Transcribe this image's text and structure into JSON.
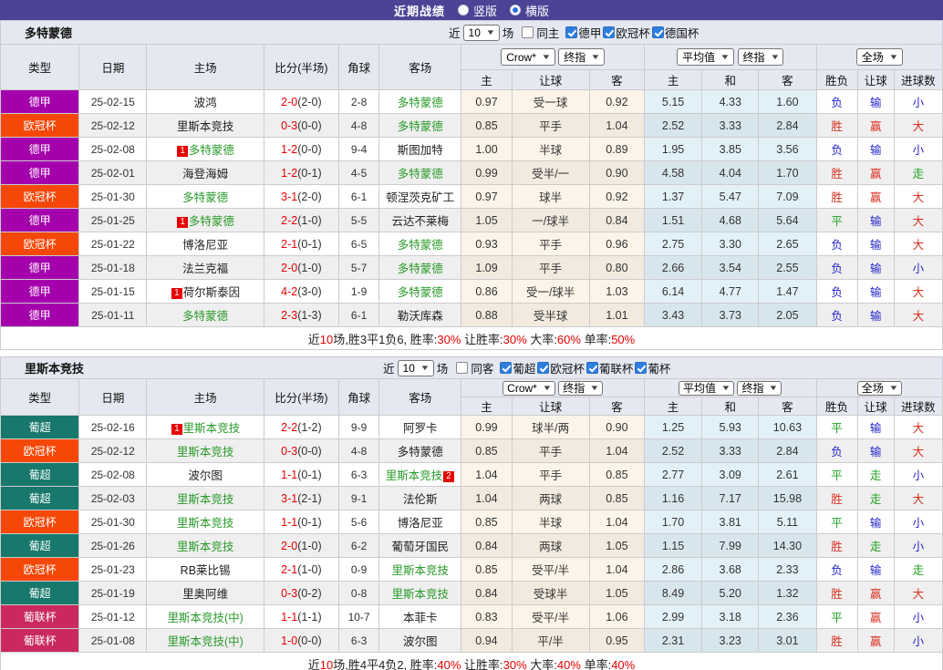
{
  "title_bar": {
    "title": "近期战绩",
    "vertical": "竖版",
    "horizontal": "横版"
  },
  "columns_left": [
    "类型",
    "日期",
    "主场",
    "比分(半场)",
    "角球",
    "客场"
  ],
  "header_row2": [
    "主",
    "让球",
    "客",
    "主",
    "和",
    "客",
    "胜负",
    "让球",
    "进球数"
  ],
  "league_colors": {
    "德甲": "#A400AC",
    "欧冠杯": "#F54708",
    "葡超": "#17786B",
    "葡联杯": "#C9295E"
  },
  "result_colors": {
    "r": "#d9301f",
    "b": "#2424c8",
    "g": "#1fa01f"
  },
  "accent_colors": {
    "titlebar": "#4B4496",
    "score_red": "#e60000",
    "team_green": "#2a9a2a",
    "rank_badge_bg": "#e60000"
  },
  "sections": [
    {
      "team": "多特蒙德",
      "filter": {
        "near": "近",
        "count": "10",
        "matches": "场",
        "same": "同主",
        "same_checked": false,
        "leagues": [
          "德甲",
          "欧冠杯",
          "德国杯"
        ]
      },
      "selects": {
        "source": "Crow*",
        "stage1": "终指",
        "avg": "平均值",
        "stage2": "终指",
        "scope": "全场"
      },
      "rows": [
        {
          "lg": "德甲",
          "d": "25-02-15",
          "h": {
            "n": "波鸿"
          },
          "ft": "2-0",
          "ht": "(2-0)",
          "cn": "2-8",
          "aw": {
            "n": "多特蒙德",
            "g": 1
          },
          "o": [
            "0.97",
            "受一球",
            "0.92"
          ],
          "v": [
            "5.15",
            "4.33",
            "1.60"
          ],
          "r": [
            [
              "负",
              "b"
            ],
            [
              "输",
              "b"
            ],
            [
              "小",
              "b"
            ]
          ]
        },
        {
          "lg": "欧冠杯",
          "d": "25-02-12",
          "h": {
            "n": "里斯本竞技"
          },
          "ft": "0-3",
          "ht": "(0-0)",
          "cn": "4-8",
          "aw": {
            "n": "多特蒙德",
            "g": 1
          },
          "o": [
            "0.85",
            "平手",
            "1.04"
          ],
          "v": [
            "2.52",
            "3.33",
            "2.84"
          ],
          "r": [
            [
              "胜",
              "r"
            ],
            [
              "赢",
              "r"
            ],
            [
              "大",
              "r"
            ]
          ]
        },
        {
          "lg": "德甲",
          "d": "25-02-08",
          "h": {
            "n": "多特蒙德",
            "g": 1,
            "rk": "1"
          },
          "ft": "1-2",
          "ht": "(0-0)",
          "cn": "9-4",
          "aw": {
            "n": "斯图加特"
          },
          "o": [
            "1.00",
            "半球",
            "0.89"
          ],
          "v": [
            "1.95",
            "3.85",
            "3.56"
          ],
          "r": [
            [
              "负",
              "b"
            ],
            [
              "输",
              "b"
            ],
            [
              "小",
              "b"
            ]
          ]
        },
        {
          "lg": "德甲",
          "d": "25-02-01",
          "h": {
            "n": "海登海姆"
          },
          "ft": "1-2",
          "ht": "(0-1)",
          "cn": "4-5",
          "aw": {
            "n": "多特蒙德",
            "g": 1
          },
          "o": [
            "0.99",
            "受半/一",
            "0.90"
          ],
          "v": [
            "4.58",
            "4.04",
            "1.70"
          ],
          "r": [
            [
              "胜",
              "r"
            ],
            [
              "赢",
              "r"
            ],
            [
              "走",
              "g"
            ]
          ]
        },
        {
          "lg": "欧冠杯",
          "d": "25-01-30",
          "h": {
            "n": "多特蒙德",
            "g": 1
          },
          "ft": "3-1",
          "ht": "(2-0)",
          "cn": "6-1",
          "aw": {
            "n": "顿涅茨克矿工"
          },
          "o": [
            "0.97",
            "球半",
            "0.92"
          ],
          "v": [
            "1.37",
            "5.47",
            "7.09"
          ],
          "r": [
            [
              "胜",
              "r"
            ],
            [
              "赢",
              "r"
            ],
            [
              "大",
              "r"
            ]
          ]
        },
        {
          "lg": "德甲",
          "d": "25-01-25",
          "h": {
            "n": "多特蒙德",
            "g": 1,
            "rk": "1"
          },
          "ft": "2-2",
          "ht": "(1-0)",
          "cn": "5-5",
          "aw": {
            "n": "云达不莱梅"
          },
          "o": [
            "1.05",
            "一/球半",
            "0.84"
          ],
          "v": [
            "1.51",
            "4.68",
            "5.64"
          ],
          "r": [
            [
              "平",
              "g"
            ],
            [
              "输",
              "b"
            ],
            [
              "大",
              "r"
            ]
          ]
        },
        {
          "lg": "欧冠杯",
          "d": "25-01-22",
          "h": {
            "n": "博洛尼亚"
          },
          "ft": "2-1",
          "ht": "(0-1)",
          "cn": "6-5",
          "aw": {
            "n": "多特蒙德",
            "g": 1
          },
          "o": [
            "0.93",
            "平手",
            "0.96"
          ],
          "v": [
            "2.75",
            "3.30",
            "2.65"
          ],
          "r": [
            [
              "负",
              "b"
            ],
            [
              "输",
              "b"
            ],
            [
              "大",
              "r"
            ]
          ]
        },
        {
          "lg": "德甲",
          "d": "25-01-18",
          "h": {
            "n": "法兰克福"
          },
          "ft": "2-0",
          "ht": "(1-0)",
          "cn": "5-7",
          "aw": {
            "n": "多特蒙德",
            "g": 1
          },
          "o": [
            "1.09",
            "平手",
            "0.80"
          ],
          "v": [
            "2.66",
            "3.54",
            "2.55"
          ],
          "r": [
            [
              "负",
              "b"
            ],
            [
              "输",
              "b"
            ],
            [
              "小",
              "b"
            ]
          ]
        },
        {
          "lg": "德甲",
          "d": "25-01-15",
          "h": {
            "n": "荷尔斯泰因",
            "rk": "1"
          },
          "ft": "4-2",
          "ht": "(3-0)",
          "cn": "1-9",
          "aw": {
            "n": "多特蒙德",
            "g": 1
          },
          "o": [
            "0.86",
            "受一/球半",
            "1.03"
          ],
          "v": [
            "6.14",
            "4.77",
            "1.47"
          ],
          "r": [
            [
              "负",
              "b"
            ],
            [
              "输",
              "b"
            ],
            [
              "大",
              "r"
            ]
          ]
        },
        {
          "lg": "德甲",
          "d": "25-01-11",
          "h": {
            "n": "多特蒙德",
            "g": 1
          },
          "ft": "2-3",
          "ht": "(1-3)",
          "cn": "6-1",
          "aw": {
            "n": "勒沃库森"
          },
          "o": [
            "0.88",
            "受半球",
            "1.01"
          ],
          "v": [
            "3.43",
            "3.73",
            "2.05"
          ],
          "r": [
            [
              "负",
              "b"
            ],
            [
              "输",
              "b"
            ],
            [
              "大",
              "r"
            ]
          ]
        }
      ],
      "summary": [
        [
          "近",
          0
        ],
        [
          "10",
          1
        ],
        [
          "场,胜3平1负6, 胜率:",
          0
        ],
        [
          "30%",
          1
        ],
        [
          " 让胜率:",
          0
        ],
        [
          "30%",
          1
        ],
        [
          " 大率:",
          0
        ],
        [
          "60%",
          1
        ],
        [
          " 单率:",
          0
        ],
        [
          "50%",
          1
        ]
      ]
    },
    {
      "team": "里斯本竞技",
      "filter": {
        "near": "近",
        "count": "10",
        "matches": "场",
        "same": "同客",
        "same_checked": false,
        "leagues": [
          "葡超",
          "欧冠杯",
          "葡联杯",
          "葡杯"
        ]
      },
      "selects": {
        "source": "Crow*",
        "stage1": "终指",
        "avg": "平均值",
        "stage2": "终指",
        "scope": "全场"
      },
      "rows": [
        {
          "lg": "葡超",
          "d": "25-02-16",
          "h": {
            "n": "里斯本竞技",
            "g": 1,
            "rk": "1"
          },
          "ft": "2-2",
          "ht": "(1-2)",
          "cn": "9-9",
          "aw": {
            "n": "阿罗卡"
          },
          "o": [
            "0.99",
            "球半/两",
            "0.90"
          ],
          "v": [
            "1.25",
            "5.93",
            "10.63"
          ],
          "r": [
            [
              "平",
              "g"
            ],
            [
              "输",
              "b"
            ],
            [
              "大",
              "r"
            ]
          ]
        },
        {
          "lg": "欧冠杯",
          "d": "25-02-12",
          "h": {
            "n": "里斯本竞技",
            "g": 1
          },
          "ft": "0-3",
          "ht": "(0-0)",
          "cn": "4-8",
          "aw": {
            "n": "多特蒙德"
          },
          "o": [
            "0.85",
            "平手",
            "1.04"
          ],
          "v": [
            "2.52",
            "3.33",
            "2.84"
          ],
          "r": [
            [
              "负",
              "b"
            ],
            [
              "输",
              "b"
            ],
            [
              "大",
              "r"
            ]
          ]
        },
        {
          "lg": "葡超",
          "d": "25-02-08",
          "h": {
            "n": "波尔图"
          },
          "ft": "1-1",
          "ht": "(0-1)",
          "cn": "6-3",
          "aw": {
            "n": "里斯本竞技",
            "g": 1,
            "rk": "2",
            "rka": 1
          },
          "o": [
            "1.04",
            "平手",
            "0.85"
          ],
          "v": [
            "2.77",
            "3.09",
            "2.61"
          ],
          "r": [
            [
              "平",
              "g"
            ],
            [
              "走",
              "g"
            ],
            [
              "小",
              "b"
            ]
          ]
        },
        {
          "lg": "葡超",
          "d": "25-02-03",
          "h": {
            "n": "里斯本竞技",
            "g": 1
          },
          "ft": "3-1",
          "ht": "(2-1)",
          "cn": "9-1",
          "aw": {
            "n": "法伦斯"
          },
          "o": [
            "1.04",
            "两球",
            "0.85"
          ],
          "v": [
            "1.16",
            "7.17",
            "15.98"
          ],
          "r": [
            [
              "胜",
              "r"
            ],
            [
              "走",
              "g"
            ],
            [
              "大",
              "r"
            ]
          ]
        },
        {
          "lg": "欧冠杯",
          "d": "25-01-30",
          "h": {
            "n": "里斯本竞技",
            "g": 1
          },
          "ft": "1-1",
          "ht": "(0-1)",
          "cn": "5-6",
          "aw": {
            "n": "博洛尼亚"
          },
          "o": [
            "0.85",
            "半球",
            "1.04"
          ],
          "v": [
            "1.70",
            "3.81",
            "5.11"
          ],
          "r": [
            [
              "平",
              "g"
            ],
            [
              "输",
              "b"
            ],
            [
              "小",
              "b"
            ]
          ]
        },
        {
          "lg": "葡超",
          "d": "25-01-26",
          "h": {
            "n": "里斯本竞技",
            "g": 1
          },
          "ft": "2-0",
          "ht": "(1-0)",
          "cn": "6-2",
          "aw": {
            "n": "葡萄牙国民"
          },
          "o": [
            "0.84",
            "两球",
            "1.05"
          ],
          "v": [
            "1.15",
            "7.99",
            "14.30"
          ],
          "r": [
            [
              "胜",
              "r"
            ],
            [
              "走",
              "g"
            ],
            [
              "小",
              "b"
            ]
          ]
        },
        {
          "lg": "欧冠杯",
          "d": "25-01-23",
          "h": {
            "n": "RB莱比锡"
          },
          "ft": "2-1",
          "ht": "(1-0)",
          "cn": "0-9",
          "aw": {
            "n": "里斯本竞技",
            "g": 1
          },
          "o": [
            "0.85",
            "受平/半",
            "1.04"
          ],
          "v": [
            "2.86",
            "3.68",
            "2.33"
          ],
          "r": [
            [
              "负",
              "b"
            ],
            [
              "输",
              "b"
            ],
            [
              "走",
              "g"
            ]
          ]
        },
        {
          "lg": "葡超",
          "d": "25-01-19",
          "h": {
            "n": "里奥阿维"
          },
          "ft": "0-3",
          "ht": "(0-2)",
          "cn": "0-8",
          "aw": {
            "n": "里斯本竞技",
            "g": 1
          },
          "o": [
            "0.84",
            "受球半",
            "1.05"
          ],
          "v": [
            "8.49",
            "5.20",
            "1.32"
          ],
          "r": [
            [
              "胜",
              "r"
            ],
            [
              "赢",
              "r"
            ],
            [
              "大",
              "r"
            ]
          ]
        },
        {
          "lg": "葡联杯",
          "d": "25-01-12",
          "h": {
            "n": "里斯本竞技(中)",
            "g": 1
          },
          "ft": "1-1",
          "ht": "(1-1)",
          "cn": "10-7",
          "aw": {
            "n": "本菲卡"
          },
          "o": [
            "0.83",
            "受平/半",
            "1.06"
          ],
          "v": [
            "2.99",
            "3.18",
            "2.36"
          ],
          "r": [
            [
              "平",
              "g"
            ],
            [
              "赢",
              "r"
            ],
            [
              "小",
              "b"
            ]
          ]
        },
        {
          "lg": "葡联杯",
          "d": "25-01-08",
          "h": {
            "n": "里斯本竞技(中)",
            "g": 1
          },
          "ft": "1-0",
          "ht": "(0-0)",
          "cn": "6-3",
          "aw": {
            "n": "波尔图"
          },
          "o": [
            "0.94",
            "平/半",
            "0.95"
          ],
          "v": [
            "2.31",
            "3.23",
            "3.01"
          ],
          "r": [
            [
              "胜",
              "r"
            ],
            [
              "赢",
              "r"
            ],
            [
              "小",
              "b"
            ]
          ]
        }
      ],
      "summary": [
        [
          "近",
          0
        ],
        [
          "10",
          1
        ],
        [
          "场,胜4平4负2, 胜率:",
          0
        ],
        [
          "40%",
          1
        ],
        [
          " 让胜率:",
          0
        ],
        [
          "30%",
          1
        ],
        [
          " 大率:",
          0
        ],
        [
          "40%",
          1
        ],
        [
          " 单率:",
          0
        ],
        [
          "40%",
          1
        ]
      ]
    }
  ]
}
